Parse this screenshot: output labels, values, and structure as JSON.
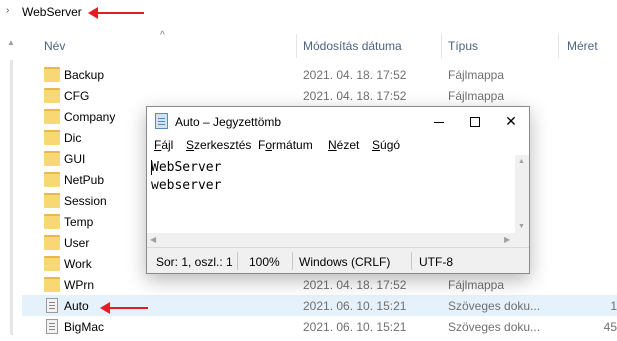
{
  "breadcrumb": {
    "chevron": "›",
    "path": "WebServer"
  },
  "columns": {
    "name": "Név",
    "modified": "Módosítás dátuma",
    "type": "Típus",
    "size": "Méret"
  },
  "sort_indicator": "^",
  "files": [
    {
      "name": "Backup",
      "date": "2021. 04. 18. 17:52",
      "type": "Fájlmappa",
      "size": "",
      "icon": "folder-icon"
    },
    {
      "name": "CFG",
      "date": "2021. 04. 18. 17:52",
      "type": "Fájlmappa",
      "size": "",
      "icon": "folder-icon"
    },
    {
      "name": "Company",
      "date": "",
      "type": "",
      "size": "",
      "icon": "folder-icon"
    },
    {
      "name": "Dic",
      "date": "",
      "type": "",
      "size": "",
      "icon": "folder-icon"
    },
    {
      "name": "GUI",
      "date": "",
      "type": "",
      "size": "",
      "icon": "folder-icon"
    },
    {
      "name": "NetPub",
      "date": "",
      "type": "",
      "size": "",
      "icon": "folder-icon"
    },
    {
      "name": "Session",
      "date": "",
      "type": "",
      "size": "",
      "icon": "folder-icon"
    },
    {
      "name": "Temp",
      "date": "",
      "type": "",
      "size": "",
      "icon": "folder-icon"
    },
    {
      "name": "User",
      "date": "",
      "type": "",
      "size": "",
      "icon": "folder-icon"
    },
    {
      "name": "Work",
      "date": "",
      "type": "Fájlmappa",
      "size": "",
      "icon": "folder-icon"
    },
    {
      "name": "WPrn",
      "date": "2021. 04. 18. 17:52",
      "type": "Fájlmappa",
      "size": "",
      "icon": "folder-icon"
    },
    {
      "name": "Auto",
      "date": "2021. 06. 10. 15:21",
      "type": "Szöveges doku...",
      "size": "1",
      "icon": "text-file-icon"
    },
    {
      "name": "BigMac",
      "date": "2021. 06. 10. 15:21",
      "type": "Szöveges doku...",
      "size": "45",
      "icon": "text-file-icon"
    }
  ],
  "notepad": {
    "title": "Auto – Jegyzettömb",
    "menu": [
      {
        "label": "Fájl",
        "key": "F",
        "rest": "ájl"
      },
      {
        "label": "Szerkesztés",
        "key": "S",
        "rest": "zerkesztés"
      },
      {
        "label": "Formátum",
        "key": "o",
        "pre": "F",
        "rest": "rmátum"
      },
      {
        "label": "Nézet",
        "key": "N",
        "rest": "ézet"
      },
      {
        "label": "Súgó",
        "key": "S",
        "rest": "úgó"
      }
    ],
    "content": "WebServer\nwebserver",
    "status": {
      "position": "Sor: 1, oszl.: 1",
      "zoom": "100%",
      "line_ending": "Windows (CRLF)",
      "encoding": "UTF-8"
    },
    "buttons": {
      "close": "✕"
    }
  },
  "colors": {
    "annotation_arrow": "#e81b23",
    "header_text": "#4d6380",
    "folder": "#f8d775"
  }
}
